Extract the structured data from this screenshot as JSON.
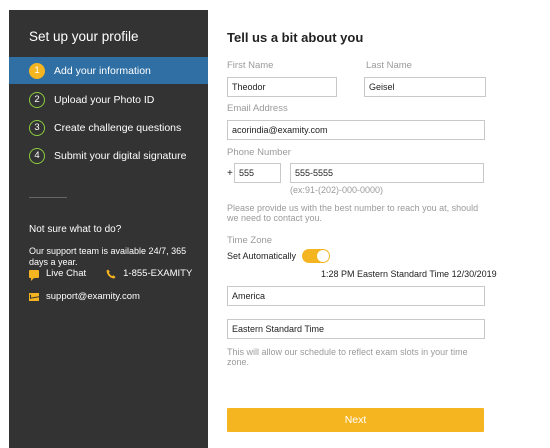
{
  "sidebar": {
    "title": "Set up your profile",
    "steps": [
      {
        "num": "1",
        "label": "Add your information"
      },
      {
        "num": "2",
        "label": "Upload your Photo ID"
      },
      {
        "num": "3",
        "label": "Create challenge questions"
      },
      {
        "num": "4",
        "label": "Submit your digital signature"
      }
    ],
    "help_title": "Not sure what to do?",
    "help_text": "Our support team is available 24/7, 365 days a year.",
    "live_chat_label": "Live Chat",
    "phone_label": "1-855-EXAMITY",
    "email_label": "support@examity.com"
  },
  "main": {
    "title": "Tell us a bit about you",
    "first_name_label": "First Name",
    "first_name_value": "Theodor",
    "last_name_label": "Last Name",
    "last_name_value": "Geisel",
    "email_label": "Email Address",
    "email_value": "acorindia@examity.com",
    "phone_label": "Phone Number",
    "phone_prefix": "+",
    "country_code_value": "555",
    "phone_value": "555-5555",
    "phone_hint": "(ex:91-(202)-000-0000)",
    "phone_note": "Please provide us with the best number to reach you at, should we need to contact you.",
    "timezone_label": "Time Zone",
    "set_auto_label": "Set Automatically",
    "time_readout": "1:28 PM Eastern Standard Time 12/30/2019",
    "region_value": "America",
    "zone_value": "Eastern Standard Time",
    "zone_note": "This will allow our schedule to reflect exam slots in your time zone.",
    "next_label": "Next"
  },
  "colors": {
    "sidebar_bg": "#333333",
    "active_step": "#2f6fa3",
    "accent": "#f5b521",
    "step_ring": "#8ccc3f"
  }
}
